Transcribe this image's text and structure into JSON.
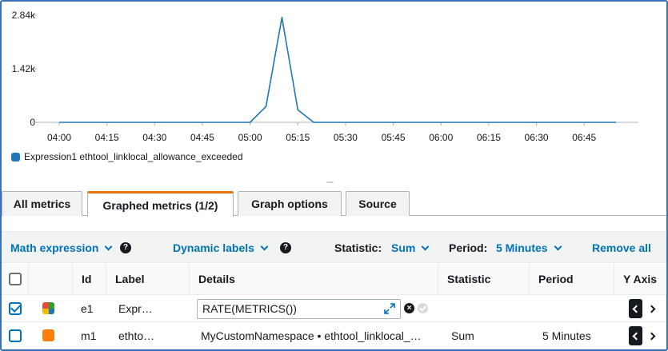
{
  "chart_data": {
    "type": "line",
    "x": [
      "04:00",
      "04:05",
      "04:10",
      "04:15",
      "04:20",
      "04:25",
      "04:30",
      "04:35",
      "04:40",
      "04:45",
      "04:50",
      "04:55",
      "05:00",
      "05:05",
      "05:10",
      "05:15",
      "05:20",
      "05:25",
      "05:30",
      "05:35",
      "05:40",
      "05:45",
      "05:50",
      "05:55",
      "06:00",
      "06:05",
      "06:10",
      "06:15",
      "06:20",
      "06:25",
      "06:30",
      "06:35",
      "06:40",
      "06:45",
      "06:50",
      "06:55"
    ],
    "series": [
      {
        "name": "Expression1 ethtool_linklocal_allowance_exceeded",
        "color": "#1f77b4",
        "values": [
          0,
          0,
          0,
          0,
          0,
          0,
          0,
          0,
          0,
          0,
          0,
          0,
          0,
          420,
          2780,
          330,
          0,
          0,
          0,
          0,
          0,
          0,
          0,
          0,
          0,
          0,
          0,
          0,
          0,
          0,
          0,
          0,
          0,
          0,
          0,
          0
        ]
      }
    ],
    "x_ticks": [
      "04:00",
      "04:15",
      "04:30",
      "04:45",
      "05:00",
      "05:15",
      "05:30",
      "05:45",
      "06:00",
      "06:15",
      "06:30",
      "06:45"
    ],
    "y_ticks": [
      {
        "value": 0,
        "label": "0"
      },
      {
        "value": 1420,
        "label": "1.42k"
      },
      {
        "value": 2840,
        "label": "2.84k"
      }
    ],
    "ylim": [
      0,
      2840
    ],
    "grid": false,
    "legend_position": "bottom-left"
  },
  "legend": {
    "label": "Expression1 ethtool_linklocal_allowance_exceeded",
    "color": "#1f77b4"
  },
  "resize_handle": "---",
  "tabs": [
    {
      "label": "All metrics",
      "active": false
    },
    {
      "label": "Graphed metrics (1/2)",
      "active": true
    },
    {
      "label": "Graph options",
      "active": false
    },
    {
      "label": "Source",
      "active": false
    }
  ],
  "toolbar": {
    "math_expression": "Math expression",
    "dynamic_labels": "Dynamic labels",
    "statistic_label": "Statistic:",
    "statistic_value": "Sum",
    "period_label": "Period:",
    "period_value": "5 Minutes",
    "remove_all": "Remove all",
    "help_glyph": "?"
  },
  "table": {
    "headers": [
      "Id",
      "Label",
      "Details",
      "Statistic",
      "Period",
      "Y Axis"
    ],
    "rows": [
      {
        "checked": true,
        "color": "multi",
        "id": "e1",
        "label": "Expr…",
        "details": "RATE(METRICS())",
        "statistic": "",
        "period": ""
      },
      {
        "checked": false,
        "color": "#ff7f0e",
        "id": "m1",
        "label": "ethto…",
        "details": "MyCustomNamespace • ethtool_linklocal_…",
        "statistic": "Sum",
        "period": "5 Minutes"
      }
    ]
  },
  "colors": {
    "accent": "#0073bb",
    "active_tab": "#ec7211",
    "series": "#1f77b4",
    "row2_color": "#ff7f0e"
  },
  "icons": {
    "dropdown": "chevron-down-icon",
    "help": "help-icon",
    "expand": "expand-icon",
    "clear": "clear-icon",
    "confirm": "check-icon"
  }
}
